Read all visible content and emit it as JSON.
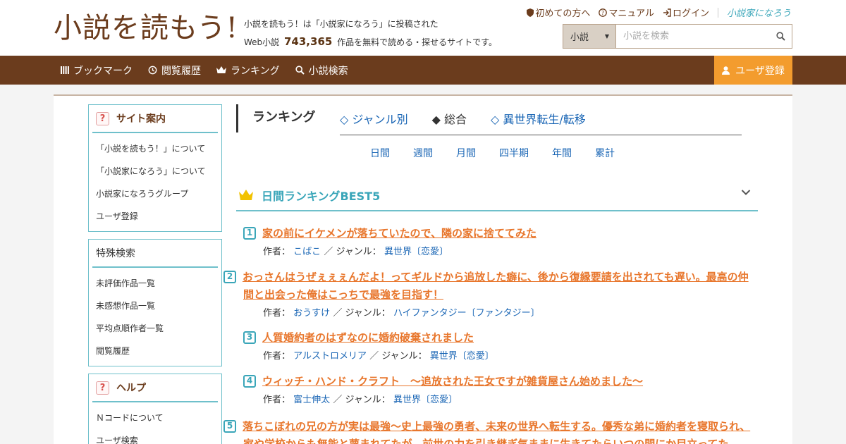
{
  "header": {
    "logo_text": "小説を読もう!",
    "tagline_line1": "小説を読もう！は「小説家になろう」に投稿された",
    "tagline_prefix": "Web小説",
    "novel_count": "743,365",
    "tagline_suffix": "作品を無料で読める・探せるサイトです。",
    "top_links": {
      "first_time": "初めての方へ",
      "manual": "マニュアル",
      "login": "ログイン",
      "narou_logo": "小説家になろう"
    },
    "search": {
      "select_value": "小説",
      "placeholder": "小説を検索"
    }
  },
  "nav": {
    "items": [
      {
        "label": "ブックマーク"
      },
      {
        "label": "閲覧履歴"
      },
      {
        "label": "ランキング"
      },
      {
        "label": "小説検索"
      }
    ],
    "register_label": "ユーザ登録"
  },
  "sidebar": {
    "site_guide": {
      "title": "サイト案内",
      "items": [
        "「小説を読もう！」について",
        "「小説家になろう」について",
        "小説家になろうグループ",
        "ユーザ登録"
      ]
    },
    "special_search": {
      "title": "特殊検索",
      "items": [
        "未評価作品一覧",
        "未感想作品一覧",
        "平均点順作者一覧",
        "閲覧履歴"
      ]
    },
    "help": {
      "title": "ヘルプ",
      "items": [
        "Ｎコードについて",
        "ユーザ検索"
      ]
    }
  },
  "ranking": {
    "title": "ランキング",
    "tabs": [
      "◇ ジャンル別",
      "◆ 総合",
      "◇ 異世界転生/転移"
    ],
    "periods": [
      "日間",
      "週間",
      "月間",
      "四半期",
      "年間",
      "累計"
    ],
    "best_title": "日間ランキングBEST5",
    "meta_author_label": "作者：",
    "meta_genre_label": "／ ジャンル：",
    "entries": [
      {
        "rank": "1",
        "title": "家の前にイケメンが落ちていたので、隣の家に捨ててみた",
        "author": "こばこ",
        "genre": "異世界〔恋愛〕"
      },
      {
        "rank": "2",
        "title": "おっさんはうぜぇぇぇんだよ！ってギルドから追放した癖に、後から復縁要請を出されても遅い。最高の仲間と出会った俺はこっちで最強を目指す！",
        "author": "おうすけ",
        "genre": "ハイファンタジー〔ファンタジー〕"
      },
      {
        "rank": "3",
        "title": "人質婚約者のはずなのに婚約破棄されました",
        "author": "アルストロメリア",
        "genre": "異世界〔恋愛〕"
      },
      {
        "rank": "4",
        "title": "ウィッチ・ハンド・クラフト　～追放された王女ですが雑貨屋さん始めました～",
        "author": "富士伸太",
        "genre": "異世界〔恋愛〕"
      },
      {
        "rank": "5",
        "title": "落ちこぼれの兄の方が実は最強〜史上最強の勇者、未来の世界へ転生する。優秀な弟に婚約者を寝取られ、家や学校からも無能と蔑まれてたが、前世の力を引き継ぎ気ままに生きてたらいつの間にか目立ってた",
        "author": "",
        "genre": ""
      }
    ]
  },
  "colors": {
    "brand_brown": "#6b3c1d",
    "accent_orange": "#f39c2e",
    "teal": "#3aa6b9",
    "link_blue": "#1a66b5",
    "title_orange": "#e8762c"
  }
}
